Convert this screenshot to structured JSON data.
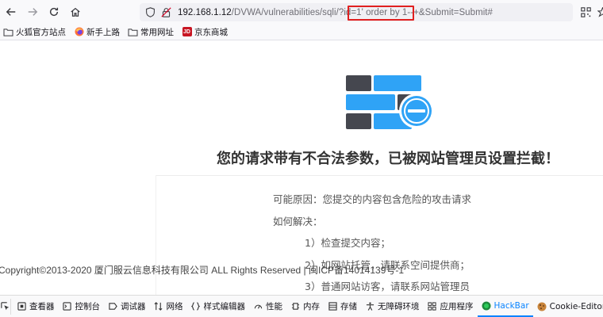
{
  "browser": {
    "url_host": "192.168.1.12",
    "url_path": "/DVWA/vulnerabilities/sqli/?id=1' order by 1--+&Submit=Submit#"
  },
  "bookmarks": [
    {
      "label": "火狐官方站点",
      "icon": "folder-icon"
    },
    {
      "label": "新手上路",
      "icon": "firefox-icon"
    },
    {
      "label": "常用网址",
      "icon": "folder-icon"
    },
    {
      "label": "京东商城",
      "icon": "jd-icon",
      "icon_text": "JD"
    }
  ],
  "page": {
    "heading": "您的请求带有不合法参数，已被网站管理员设置拦截！",
    "reason": "可能原因：您提交的内容包含危险的攻击请求",
    "how_to": "如何解决：",
    "steps": [
      "1）检查提交内容；",
      "2）如网站托管，请联系空间提供商；",
      "3）普通网站访客，请联系网站管理员"
    ],
    "copyright": "Copyright©2013-2020 厦门服云信息科技有限公司 ALL Rights Reserved | 闽ICP备14014139号-1"
  },
  "devtools": {
    "tabs": [
      {
        "label": "查看器",
        "icon": "inspector-icon"
      },
      {
        "label": "控制台",
        "icon": "console-icon"
      },
      {
        "label": "调试器",
        "icon": "debugger-icon"
      },
      {
        "label": "网络",
        "icon": "network-icon"
      },
      {
        "label": "样式编辑器",
        "icon": "style-editor-icon"
      },
      {
        "label": "性能",
        "icon": "performance-icon"
      },
      {
        "label": "内存",
        "icon": "memory-icon"
      },
      {
        "label": "存储",
        "icon": "storage-icon"
      },
      {
        "label": "无障碍环境",
        "icon": "accessibility-icon"
      },
      {
        "label": "应用程序",
        "icon": "application-icon"
      },
      {
        "label": "HackBar",
        "icon": "hackbar-icon",
        "active": true
      },
      {
        "label": "Cookie-Editor",
        "icon": "cookie-icon"
      }
    ]
  },
  "colors": {
    "accent": "#0a84ff",
    "highlight_box": "#e02020",
    "block_blue": "#2fa3f6",
    "block_dark": "#45474f"
  }
}
